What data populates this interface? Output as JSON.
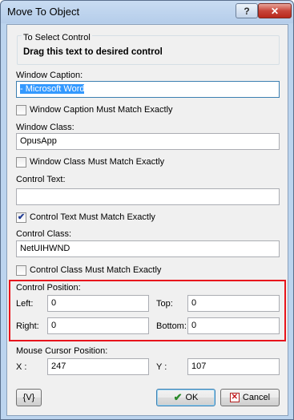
{
  "window": {
    "title": "Move To Object",
    "help_glyph": "?",
    "close_glyph": "✕"
  },
  "select_group": {
    "legend": "To Select Control",
    "drag_text": "Drag this text to desired control"
  },
  "window_caption": {
    "label": "Window Caption:",
    "value": "- Microsoft Word",
    "match_label": "Window Caption Must Match Exactly",
    "match_checked": false
  },
  "window_class": {
    "label": "Window Class:",
    "value": "OpusApp",
    "match_label": "Window Class Must Match  Exactly",
    "match_checked": false
  },
  "control_text": {
    "label": "Control Text:",
    "value": "",
    "match_label": "Control Text Must Match Exactly",
    "match_checked": true
  },
  "control_class": {
    "label": "Control Class:",
    "value": "NetUIHWND",
    "match_label": "Control Class Must Match  Exactly",
    "match_checked": false
  },
  "control_position": {
    "label": "Control Position:",
    "left_label": "Left:",
    "left_value": "0",
    "top_label": "Top:",
    "top_value": "0",
    "right_label": "Right:",
    "right_value": "0",
    "bottom_label": "Bottom:",
    "bottom_value": "0"
  },
  "mouse_position": {
    "label": "Mouse Cursor Position:",
    "x_label": "X :",
    "x_value": "247",
    "y_label": "Y :",
    "y_value": "107"
  },
  "buttons": {
    "variable_label": "{V}",
    "ok_label": "OK",
    "cancel_label": "Cancel"
  },
  "icons": {
    "check": "✔",
    "ok": "✔",
    "cancel": "✕"
  }
}
